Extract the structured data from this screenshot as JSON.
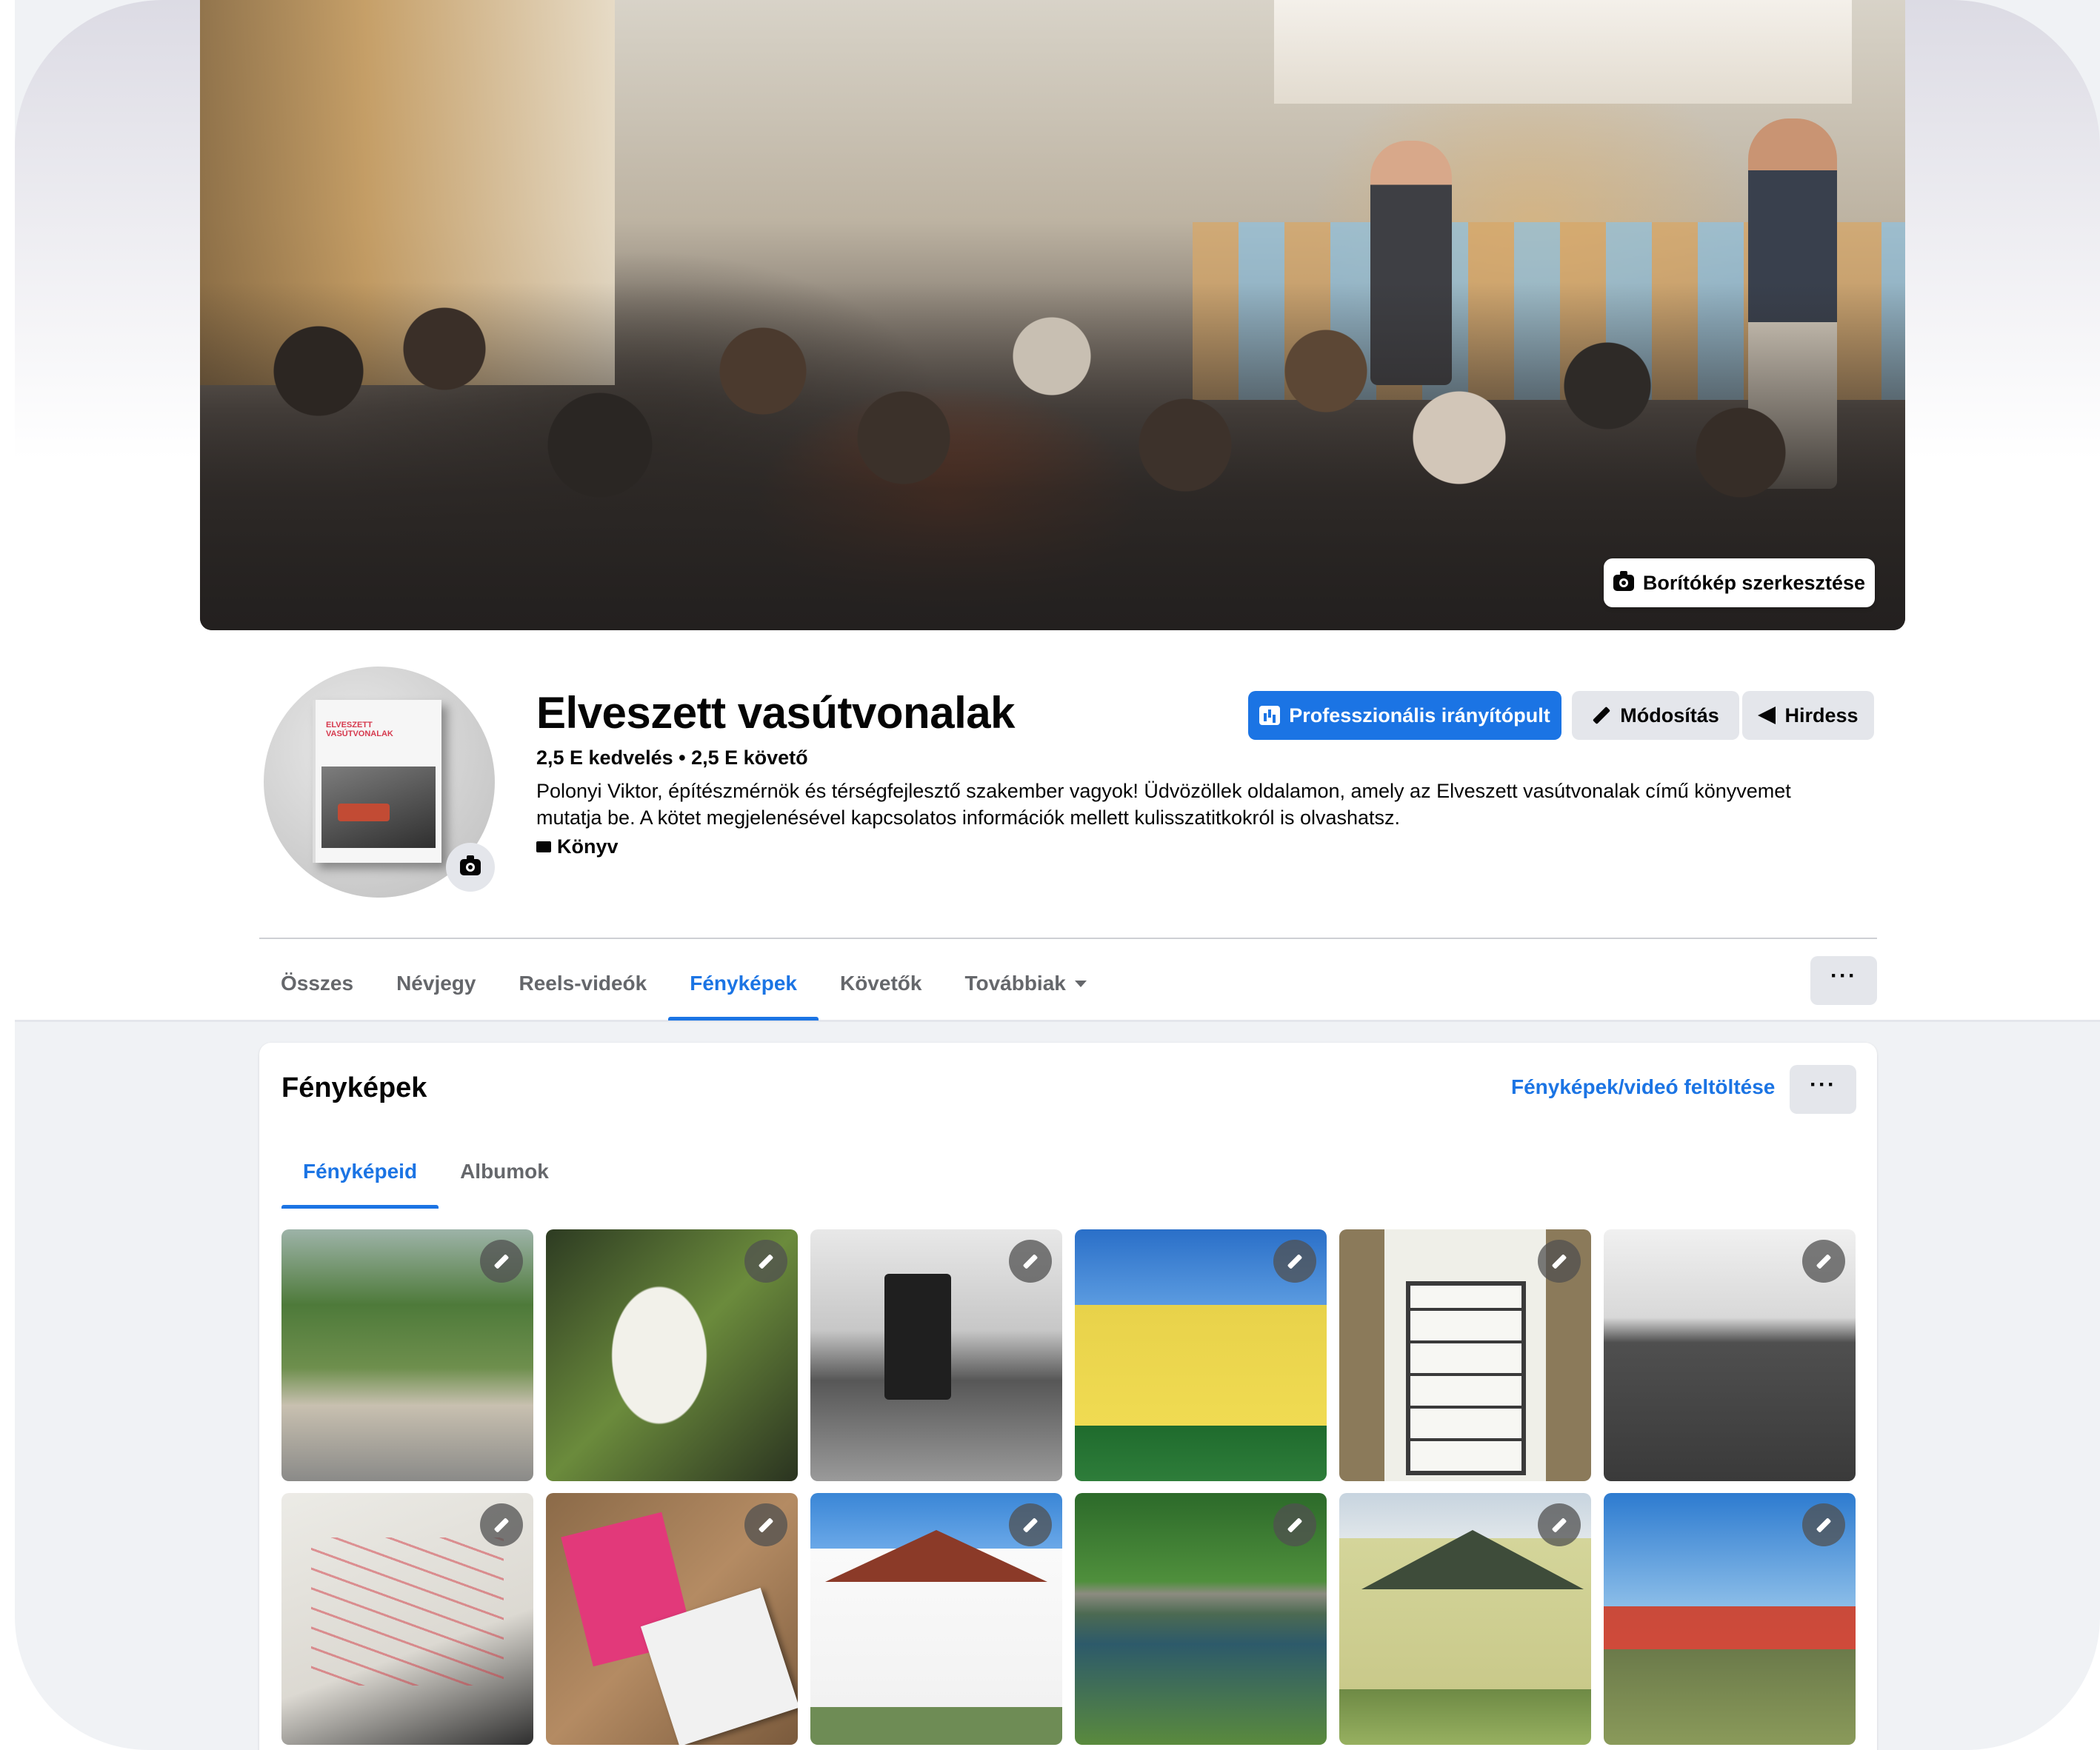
{
  "cover": {
    "edit_label": "Borítókép szerkesztése"
  },
  "profile": {
    "name": "Elveszett vasútvonalak",
    "stats": "2,5 E kedvelés • 2,5 E követő",
    "bio": "Polonyi Viktor, építészmérnök és térségfejlesztő szakember vagyok! Üdvözöllek oldalamon, amely az Elveszett vasútvonalak című könyvemet mutatja be. A kötet megjelenésével kapcsolatos információk mellett kulisszatitkokról is olvashatsz.",
    "category": "Könyv",
    "avatar_book_title": "ELVESZETT VASÚTVONALAK"
  },
  "actions": {
    "dashboard": "Professzionális irányítópult",
    "edit": "Módosítás",
    "advertise": "Hirdess"
  },
  "tabs": [
    {
      "label": "Összes",
      "active": false
    },
    {
      "label": "Névjegy",
      "active": false
    },
    {
      "label": "Reels-videók",
      "active": false
    },
    {
      "label": "Fényképek",
      "active": true
    },
    {
      "label": "Követők",
      "active": false
    },
    {
      "label": "Továbbiak",
      "active": false
    }
  ],
  "more_button": "···",
  "photos": {
    "title": "Fényképek",
    "upload": "Fényképek/videó feltöltése",
    "more": "···",
    "subtabs": [
      {
        "label": "Fényképeid",
        "active": true
      },
      {
        "label": "Albumok",
        "active": false
      }
    ]
  },
  "colors": {
    "accent": "#1b74e4",
    "button_gray": "#e4e6eb",
    "text_secondary": "#65676b",
    "background": "#f0f2f5"
  }
}
